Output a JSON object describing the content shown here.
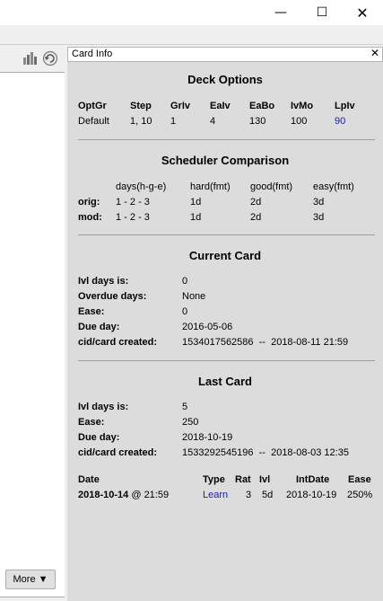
{
  "window": {
    "minimize_glyph": "—",
    "maximize_glyph": "☐",
    "close_glyph": "✕"
  },
  "left_pane": {
    "more_button": "More",
    "more_arrow": "▼",
    "icons": [
      "bar-chart-icon",
      "refresh-icon"
    ]
  },
  "card_info": {
    "title": "Card Info",
    "close_glyph": "✕",
    "deck_options": {
      "heading": "Deck Options",
      "headers": [
        "OptGr",
        "Step",
        "GrIv",
        "EaIv",
        "EaBo",
        "IvMo",
        "LpIv"
      ],
      "values": [
        "Default",
        "1, 10",
        "1",
        "4",
        "130",
        "100",
        "90"
      ]
    },
    "scheduler": {
      "heading": "Scheduler Comparison",
      "headers": [
        "days(h-g-e)",
        "hard(fmt)",
        "good(fmt)",
        "easy(fmt)"
      ],
      "rows": [
        {
          "label": "orig:",
          "cells": [
            "1 - 2 - 3",
            "1d",
            "2d",
            "3d"
          ]
        },
        {
          "label": "mod:",
          "cells": [
            "1 - 2 - 3",
            "1d",
            "2d",
            "3d"
          ]
        }
      ]
    },
    "current_card": {
      "heading": "Current Card",
      "fields": [
        {
          "label": "Ivl days is:",
          "value": "0"
        },
        {
          "label": "Overdue days:",
          "value": "None"
        },
        {
          "label": "Ease:",
          "value": "0"
        },
        {
          "label": "Due day:",
          "value": "2016-05-06"
        },
        {
          "label": "cid/card created:",
          "value": "1534017562586  --  2018-08-11 21:59"
        }
      ]
    },
    "last_card": {
      "heading": "Last Card",
      "fields": [
        {
          "label": "Ivl days is:",
          "value": "5"
        },
        {
          "label": "Ease:",
          "value": "250"
        },
        {
          "label": "Due day:",
          "value": "2018-10-19"
        },
        {
          "label": "cid/card created:",
          "value": "1533292545196  --  2018-08-03 12:35"
        }
      ]
    },
    "review_log": {
      "headers": [
        "Date",
        "Type",
        "Rat",
        "Ivl",
        "IntDate",
        "Ease"
      ],
      "rows": [
        {
          "date": "2018-10-14",
          "time": "@ 21:59",
          "type": "Learn",
          "rat": "3",
          "ivl": "5d",
          "intdate": "2018-10-19",
          "ease": "250%"
        }
      ]
    }
  }
}
